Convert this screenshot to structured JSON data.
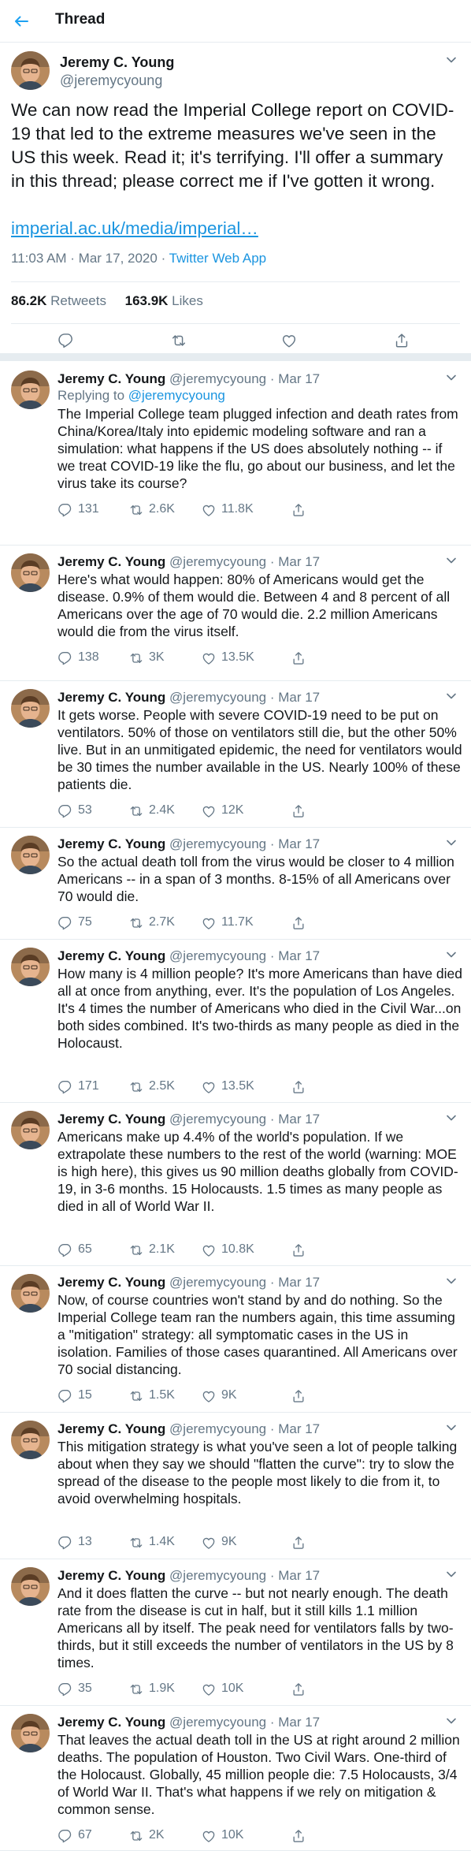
{
  "header": {
    "title": "Thread"
  },
  "main_tweet": {
    "name": "Jeremy C. Young",
    "handle": "@jeremycyoung",
    "text": "We can now read the Imperial College report on COVID-19 that led to the extreme measures we've seen in the US this week. Read it; it's terrifying. I'll offer a summary in this thread; please correct me if I've gotten it wrong.",
    "link": "imperial.ac.uk/media/imperial…",
    "time": "11:03 AM · Mar 17, 2020 · ",
    "source": "Twitter Web App",
    "retweets": "86.2K",
    "retweets_label": "Retweets",
    "likes": "163.9K",
    "likes_label": "Likes"
  },
  "replies": [
    {
      "name": "Jeremy C. Young",
      "meta": " @jeremycyoung · Mar 17",
      "replying_prefix": "Replying to ",
      "replying_to": "@jeremycyoung",
      "text": "The Imperial College team plugged infection and death rates from China/Korea/Italy into epidemic modeling software and ran a simulation: what happens if the US does absolutely nothing -- if we treat COVID-19 like the flu, go about our business, and let the virus take its course?",
      "replies": "131",
      "retweets": "2.6K",
      "likes": "11.8K"
    },
    {
      "name": "Jeremy C. Young",
      "meta": " @jeremycyoung · Mar 17",
      "text": "Here's what would happen: 80% of Americans would get the disease. 0.9% of them would die. Between 4 and 8 percent of all Americans over the age of 70 would die. 2.2 million Americans would die from the virus itself.",
      "replies": "138",
      "retweets": "3K",
      "likes": "13.5K"
    },
    {
      "name": "Jeremy C. Young",
      "meta": " @jeremycyoung · Mar 17",
      "text": "It gets worse. People with severe COVID-19 need to be put on ventilators. 50% of those on ventilators still die, but the other 50% live. But in an unmitigated epidemic, the need for ventilators would be 30 times the number available in the US. Nearly 100% of these patients die.",
      "replies": "53",
      "retweets": "2.4K",
      "likes": "12K"
    },
    {
      "name": "Jeremy C. Young",
      "meta": " @jeremycyoung · Mar 17",
      "text": "So the actual death toll from the virus would be closer to 4 million Americans -- in a span of 3 months. 8-15% of all Americans over 70 would die.",
      "replies": "75",
      "retweets": "2.7K",
      "likes": "11.7K"
    },
    {
      "name": "Jeremy C. Young",
      "meta": " @jeremycyoung · Mar 17",
      "text": "How many is 4 million people? It's more Americans than have died all at once from anything, ever. It's the population of Los Angeles. It's 4 times the number of Americans who died in the Civil War...on both sides combined. It's two-thirds as many people as died in the Holocaust.",
      "replies": "171",
      "retweets": "2.5K",
      "likes": "13.5K"
    },
    {
      "name": "Jeremy C. Young",
      "meta": " @jeremycyoung · Mar 17",
      "text": "Americans make up 4.4% of the world's population. If we extrapolate these numbers to the rest of the world (warning: MOE is high here), this gives us 90 million deaths globally from COVID-19, in 3-6 months. 15 Holocausts. 1.5 times as many people as died in all of World War II.",
      "replies": "65",
      "retweets": "2.1K",
      "likes": "10.8K"
    },
    {
      "name": "Jeremy C. Young",
      "meta": " @jeremycyoung · Mar 17",
      "text": "Now, of course countries won't stand by and do nothing. So the Imperial College team ran the numbers again, this time assuming a \"mitigation\" strategy: all symptomatic cases in the US in isolation. Families of those cases quarantined. All Americans over 70 social distancing.",
      "replies": "15",
      "retweets": "1.5K",
      "likes": "9K"
    },
    {
      "name": "Jeremy C. Young",
      "meta": " @jeremycyoung · Mar 17",
      "text": "This mitigation strategy is what you've seen a lot of people talking about when they say we should \"flatten the curve\": try to slow the spread of the disease to the people most likely to die from it, to avoid overwhelming hospitals.",
      "replies": "13",
      "retweets": "1.4K",
      "likes": "9K"
    },
    {
      "name": "Jeremy C. Young",
      "meta": " @jeremycyoung · Mar 17",
      "text": "And it does flatten the curve -- but not nearly enough. The death rate from the disease is cut in half, but it still kills 1.1 million Americans all by itself. The peak need for ventilators falls by two-thirds, but it still exceeds the number of ventilators in the US by 8 times.",
      "replies": "35",
      "retweets": "1.9K",
      "likes": "10K"
    },
    {
      "name": "Jeremy C. Young",
      "meta": " @jeremycyoung · Mar 17",
      "text": "That leaves the actual death toll in the US at right around 2 million deaths. The population of Houston. Two Civil Wars. One-third of the Holocaust. Globally, 45 million people die: 7.5 Holocausts, 3/4 of World War II. That's what happens if we rely on mitigation & common sense.",
      "replies": "67",
      "retweets": "2K",
      "likes": "10K"
    }
  ],
  "icons": {
    "back": "back-arrow-icon",
    "caret": "chevron-down-icon",
    "reply": "reply-icon",
    "retweet": "retweet-icon",
    "like": "heart-icon",
    "share": "share-icon"
  },
  "colors": {
    "accent": "#1da1f2",
    "link": "#1b95e0",
    "secondary_text": "#657786",
    "divider": "#e6ecf0"
  }
}
